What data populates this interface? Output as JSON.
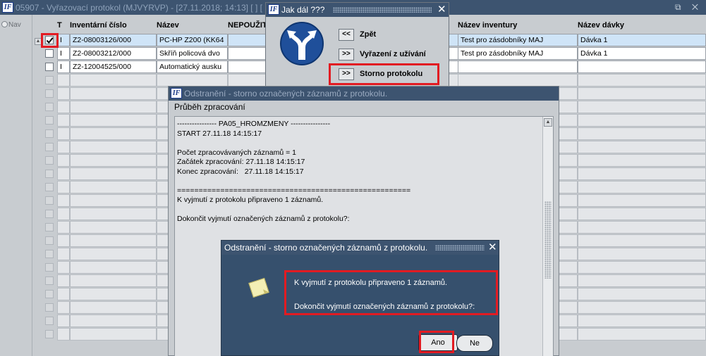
{
  "main_window": {
    "title": "05907 - Vyřazovací protokol (MJVYRVP) - [27.11.2018; 14:13]  [ ]  [",
    "logo": "IF",
    "controls": "⧉ ✕"
  },
  "left_panel": {
    "nav_label": "Nav"
  },
  "grid": {
    "headers": {
      "t": "T",
      "inventory_number": "Inventární číslo",
      "name": "Název",
      "unusable": "NEPOUŽIT",
      "inventory_name": "Název inventury",
      "batch_name": "Název dávky"
    },
    "rows": [
      {
        "checked": true,
        "t": "I",
        "inventory_number": "Z2-08003126/000",
        "name": "PC-HP Z200 (KK64",
        "inventory_name": "Test pro zásdobníky MAJ",
        "batch_name": "Dávka 1"
      },
      {
        "checked": false,
        "t": "I",
        "inventory_number": "Z2-08003212/000",
        "name": "Skříň policová dvo",
        "inventory_name": "Test pro zásdobníky MAJ",
        "batch_name": "Dávka 1"
      },
      {
        "checked": false,
        "t": "I",
        "inventory_number": "Z2-12004525/000",
        "name": "Automatický ausku",
        "inventory_name": "",
        "batch_name": ""
      }
    ]
  },
  "jak_dal_dialog": {
    "title": "Jak dál ???",
    "close": "✕",
    "buttons": [
      {
        "symbol": "<<",
        "label": "Zpět"
      },
      {
        "symbol": ">>",
        "label": "Vyřazení z užívání"
      },
      {
        "symbol": ">>",
        "label": "Storno protokolu"
      }
    ]
  },
  "progress_window": {
    "title": "Odstranění - storno označených záznamů z protokolu.",
    "subtitle": "Průběh zpracování",
    "log": "---------------- PA05_HROMZMENY ----------------\nSTART 27.11.18 14:15:17\n\nPočet zpracovávaných záznamů = 1\nZačátek zpracování: 27.11.18 14:15:17\nKonec zpracování:   27.11.18 14:15:17\n\n======================================================\nK vyjmutí z protokolu připraveno 1 záznamů.\n\nDokončit vyjmutí označených záznamů z protokolu?:"
  },
  "confirm_dialog": {
    "title": "Odstranění - storno označených záznamů z protokolu.",
    "close": "✕",
    "message_line1": "K vyjmutí z protokolu připraveno 1 záznamů.",
    "message_line2": "Dokončit vyjmutí označených záznamů z protokolu?:",
    "yes_label": "Ano",
    "no_label": "Ne"
  },
  "colors": {
    "title_bar": "#3d5470",
    "highlight": "#e21b22",
    "selected_row": "#cfe4f7"
  }
}
